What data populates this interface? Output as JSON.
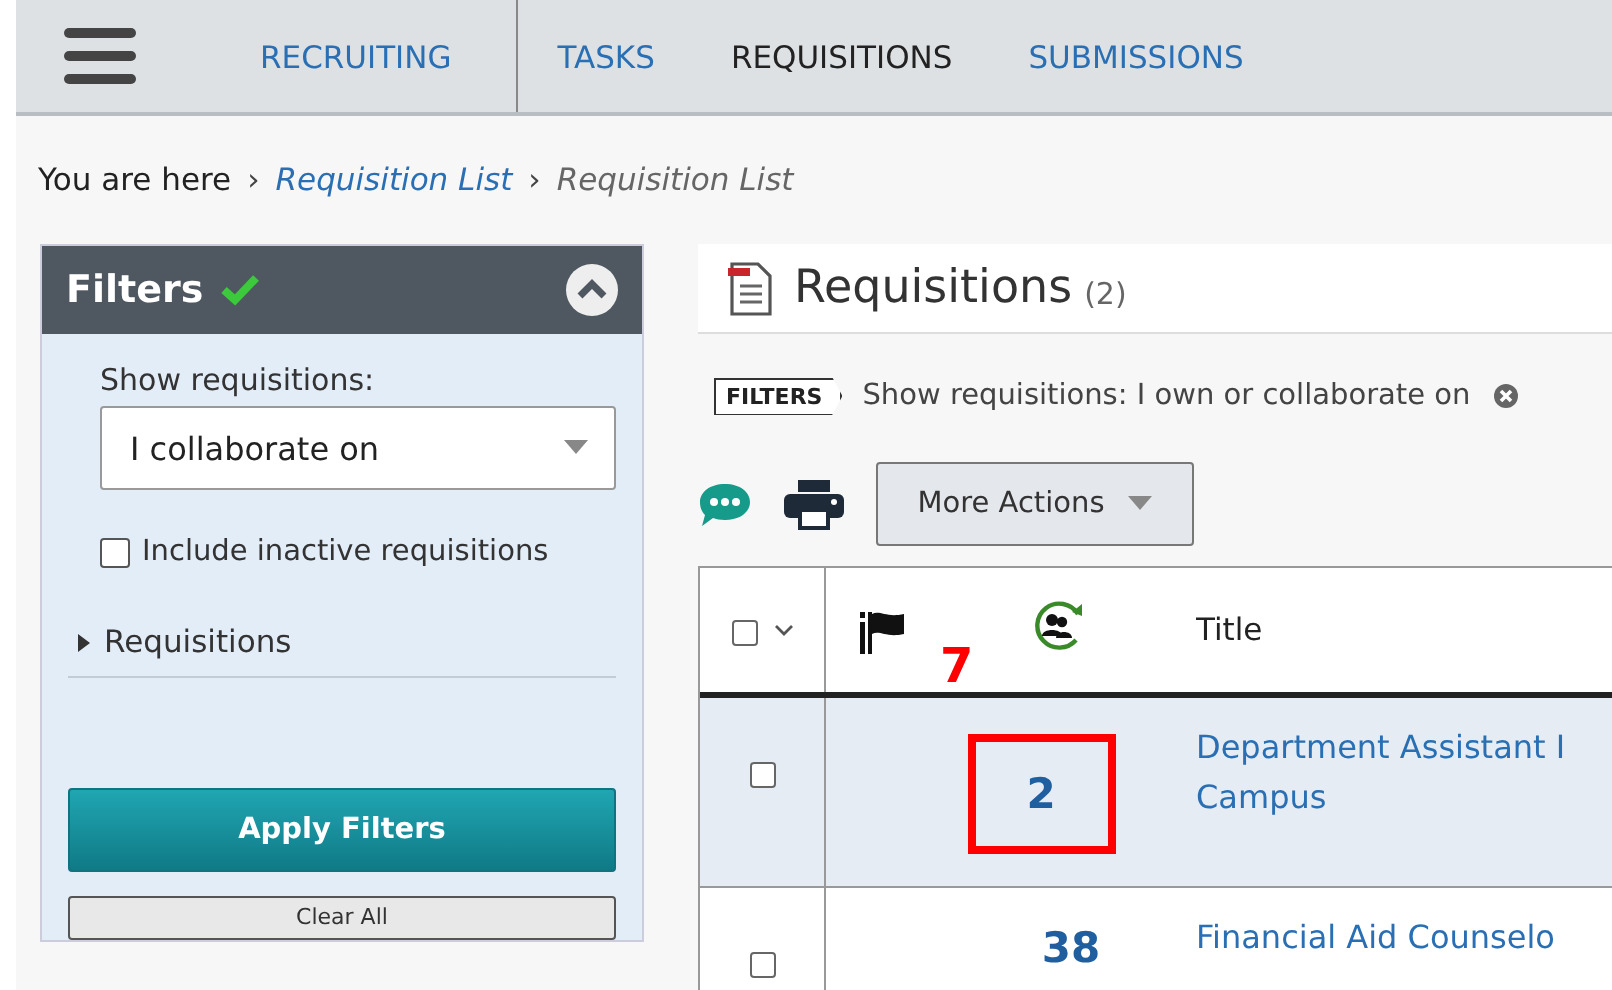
{
  "nav": {
    "items": [
      {
        "label": "RECRUITING",
        "selected": false
      },
      {
        "label": "TASKS",
        "selected": false
      },
      {
        "label": "REQUISITIONS",
        "selected": true
      },
      {
        "label": "SUBMISSIONS",
        "selected": false
      }
    ]
  },
  "breadcrumb": {
    "lead": "You are here",
    "items": [
      {
        "sep": "›",
        "label": "Requisition List",
        "link": true
      },
      {
        "sep": "›",
        "label": "Requisition List",
        "link": false
      }
    ]
  },
  "filters": {
    "title": "Filters",
    "applied": true,
    "expanded": true,
    "show_label": "Show requisitions:",
    "show_value": "I collaborate on",
    "include_inactive": {
      "label": "Include inactive requisitions",
      "checked": false
    },
    "section": {
      "label": "Requisitions",
      "expanded": false
    },
    "apply": "Apply Filters",
    "clear": "Clear All"
  },
  "header": {
    "title": "Requisitions",
    "count": "(2)"
  },
  "filter_tag": {
    "tag": "FILTERS",
    "text": "Show requisitions: I own or collaborate on"
  },
  "toolbar": {
    "more_actions": "More Actions"
  },
  "table": {
    "columns": [
      {
        "kind": "select",
        "checked": false
      },
      {
        "kind": "flag"
      },
      {
        "kind": "candidates"
      },
      {
        "kind": "text",
        "label": "Title"
      }
    ],
    "rows": [
      {
        "selected": false,
        "checked": false,
        "candidates": "2",
        "annotation": "7",
        "title": [
          "Department Assistant I",
          "Campus"
        ]
      },
      {
        "selected": false,
        "checked": false,
        "candidates": "38",
        "title": [
          "Financial Aid Counselo"
        ]
      }
    ]
  }
}
